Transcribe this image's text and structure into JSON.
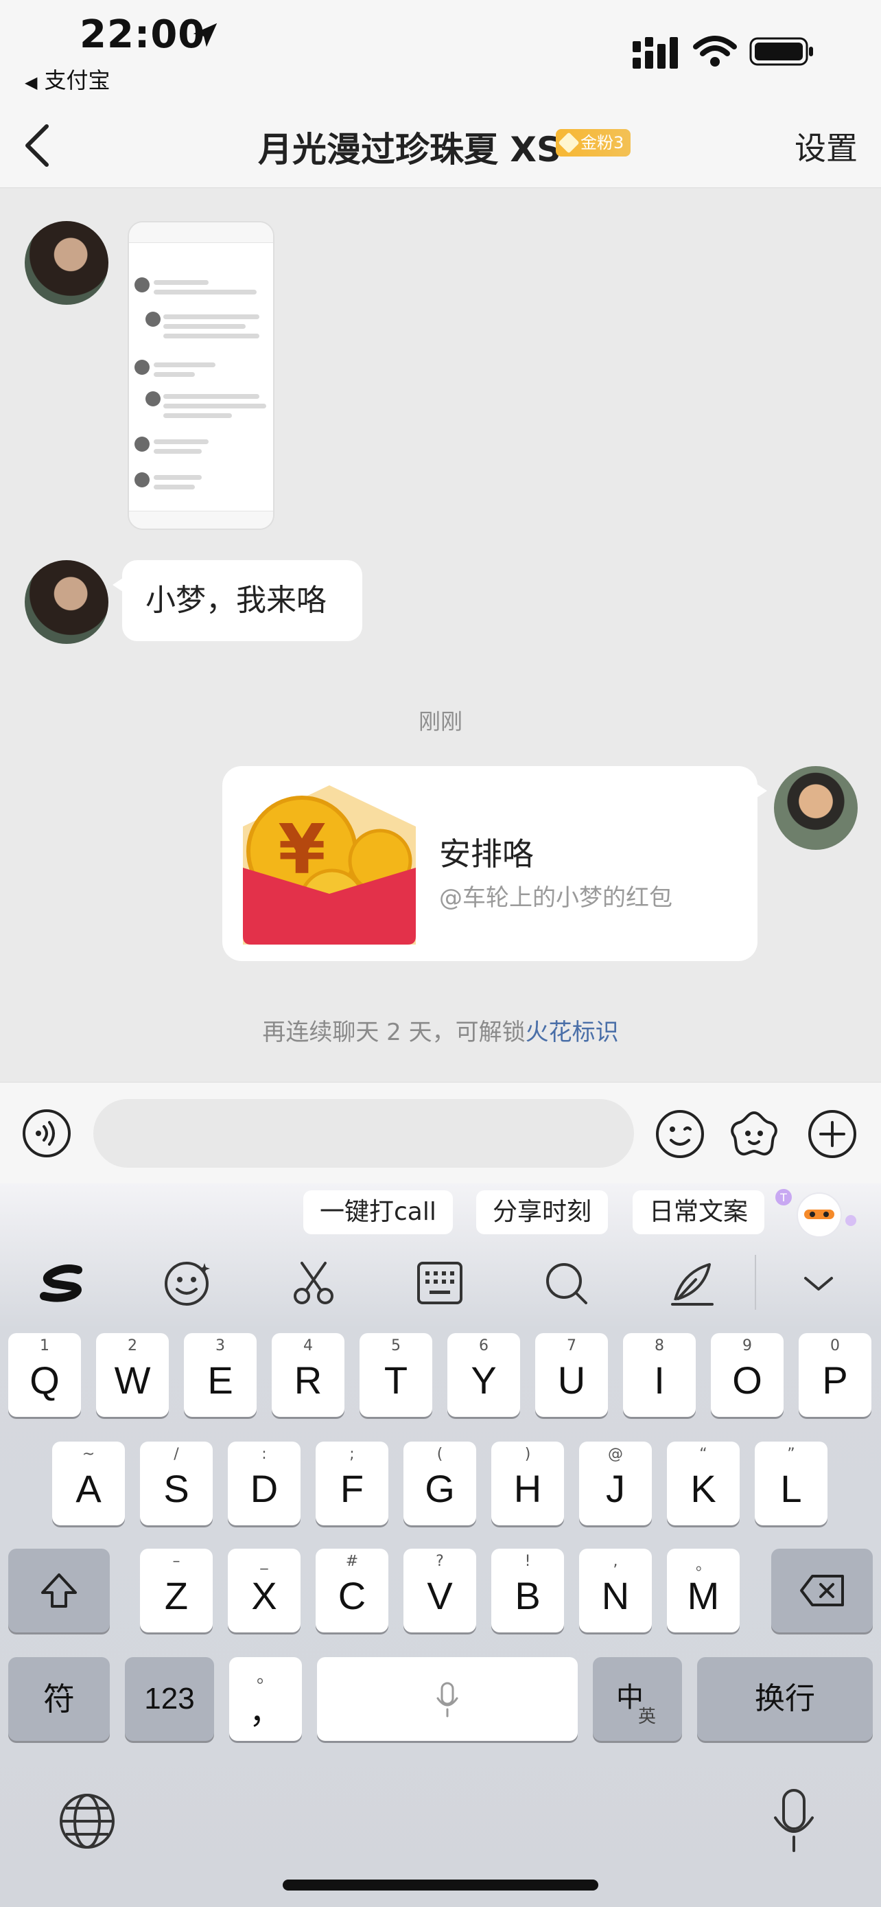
{
  "status_bar": {
    "time": "22:00",
    "back_app": "支付宝"
  },
  "nav": {
    "title": "月光漫过珍珠夏 XS",
    "fan_badge": "金粉3",
    "settings": "设置"
  },
  "chat": {
    "incoming_message": "小梦，我来咯",
    "time_divider": "刚刚",
    "red_packet": {
      "title": "安排咯",
      "subtitle": "@车轮上的小梦的红包"
    },
    "spark_hint": {
      "prefix": "再连续聊天 2 天，可解锁",
      "link": "火花标识"
    }
  },
  "input": {
    "placeholder": ""
  },
  "keyboard": {
    "suggestions": [
      "一键打call",
      "分享时刻",
      "日常文案"
    ],
    "row1": [
      {
        "main": "Q",
        "sub": "1"
      },
      {
        "main": "W",
        "sub": "2"
      },
      {
        "main": "E",
        "sub": "3"
      },
      {
        "main": "R",
        "sub": "4"
      },
      {
        "main": "T",
        "sub": "5"
      },
      {
        "main": "Y",
        "sub": "6"
      },
      {
        "main": "U",
        "sub": "7"
      },
      {
        "main": "I",
        "sub": "8"
      },
      {
        "main": "O",
        "sub": "9"
      },
      {
        "main": "P",
        "sub": "0"
      }
    ],
    "row2": [
      {
        "main": "A",
        "sub": "~"
      },
      {
        "main": "S",
        "sub": "/"
      },
      {
        "main": "D",
        "sub": ":"
      },
      {
        "main": "F",
        "sub": ";"
      },
      {
        "main": "G",
        "sub": "("
      },
      {
        "main": "H",
        "sub": ")"
      },
      {
        "main": "J",
        "sub": "@"
      },
      {
        "main": "K",
        "sub": "“"
      },
      {
        "main": "L",
        "sub": "”"
      }
    ],
    "row3": [
      {
        "main": "Z",
        "sub": "–"
      },
      {
        "main": "X",
        "sub": "_"
      },
      {
        "main": "C",
        "sub": "#"
      },
      {
        "main": "V",
        "sub": "?"
      },
      {
        "main": "B",
        "sub": "!"
      },
      {
        "main": "N",
        "sub": ","
      },
      {
        "main": "M",
        "sub": "。"
      }
    ],
    "symbols_key": "符",
    "numbers_key": "123",
    "punct_key_main": "，",
    "punct_key_sub": "。",
    "lang_key_main": "中",
    "lang_key_sub": "英",
    "return_key": "换行"
  },
  "colors": {
    "accent_link": "#4a6fa8",
    "red_packet": "#e3314a",
    "fan_badge": "#f7b733"
  }
}
